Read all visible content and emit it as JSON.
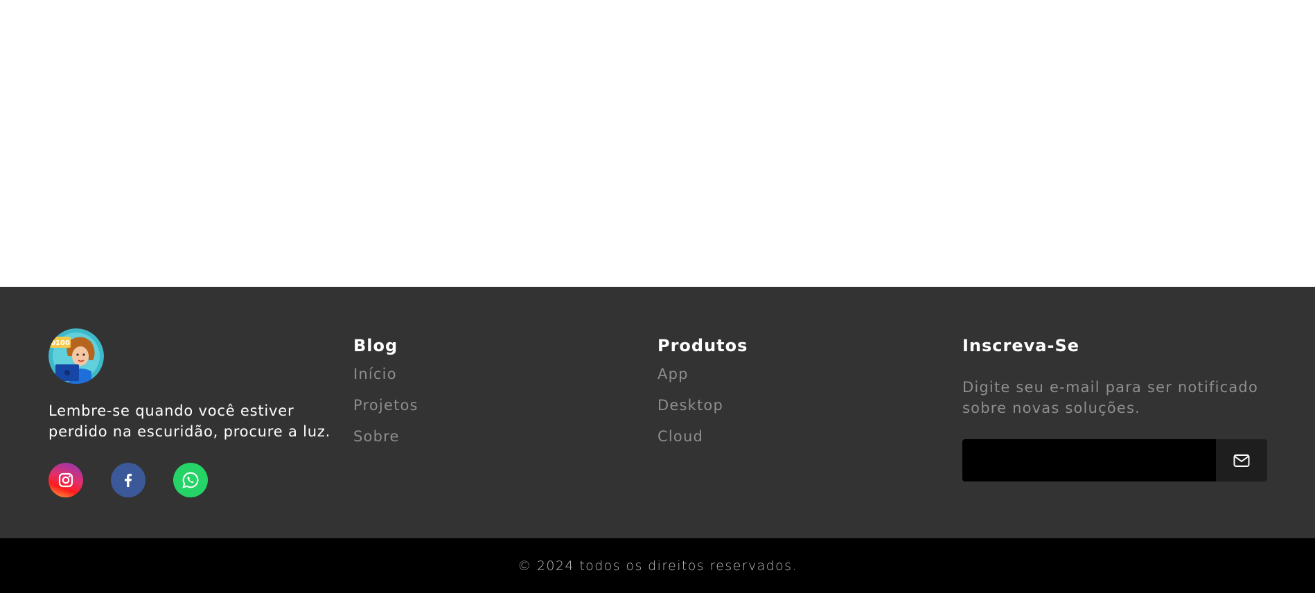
{
  "brand": {
    "avatar_icon": "developer-avatar-icon",
    "avatar_badge_text": "0100",
    "tagline": "Lembre-se quando você estiver perdido na escuridão, procure a luz."
  },
  "socials": [
    {
      "name": "Instagram",
      "icon": "instagram-icon",
      "color": "#e1306c"
    },
    {
      "name": "Facebook",
      "icon": "facebook-icon",
      "color": "#3b5998"
    },
    {
      "name": "WhatsApp",
      "icon": "whatsapp-icon",
      "color": "#25d366"
    }
  ],
  "blog": {
    "title": "Blog",
    "links": [
      "Início",
      "Projetos",
      "Sobre"
    ]
  },
  "products": {
    "title": "Produtos",
    "links": [
      "App",
      "Desktop",
      "Cloud"
    ]
  },
  "subscribe": {
    "title": "Inscreva-Se",
    "description": "Digite seu e-mail para ser notificado sobre novas soluções.",
    "email_value": "",
    "button_icon": "envelope-icon"
  },
  "footer": {
    "copyright": "© 2024 todos os direitos reservados."
  },
  "colors": {
    "footer_bg": "#333333",
    "bottom_bar_bg": "#000000",
    "link_gray": "#8e8e8e"
  }
}
